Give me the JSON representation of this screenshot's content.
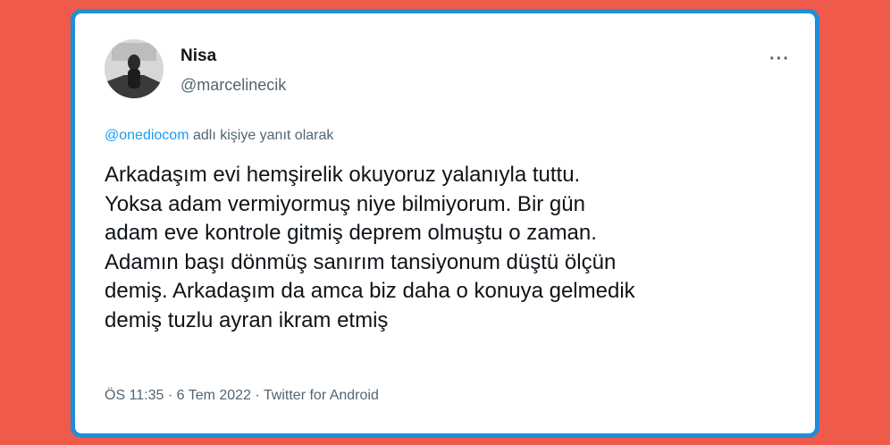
{
  "tweet": {
    "author_name": "Nisa",
    "author_handle": "@marcelinecik",
    "more_label": "···",
    "reply_mention": "@onediocom",
    "reply_text": " adlı kişiye yanıt olarak",
    "text_lines": [
      "Arkadaşım evi hemşirelik okuyoruz yalanıyla tuttu.",
      "Yoksa adam vermiyormuş niye bilmiyorum. Bir gün",
      "adam eve kontrole gitmiş deprem olmuştu o zaman.",
      "Adamın başı dönmüş sanırım tansiyonum düştü ölçün",
      "demiş. Arkadaşım da amca biz daha o konuya gelmedik",
      "demiş tuzlu ayran ikram etmiş"
    ],
    "time": "ÖS 11:35",
    "date": "6 Tem 2022",
    "source": "Twitter for Android",
    "separator": " · "
  },
  "colors": {
    "background": "#F05A4A",
    "frame_border": "#1E8FD8",
    "link": "#1d9bf0",
    "secondary_text": "#536471",
    "primary_text": "#0f1419"
  }
}
